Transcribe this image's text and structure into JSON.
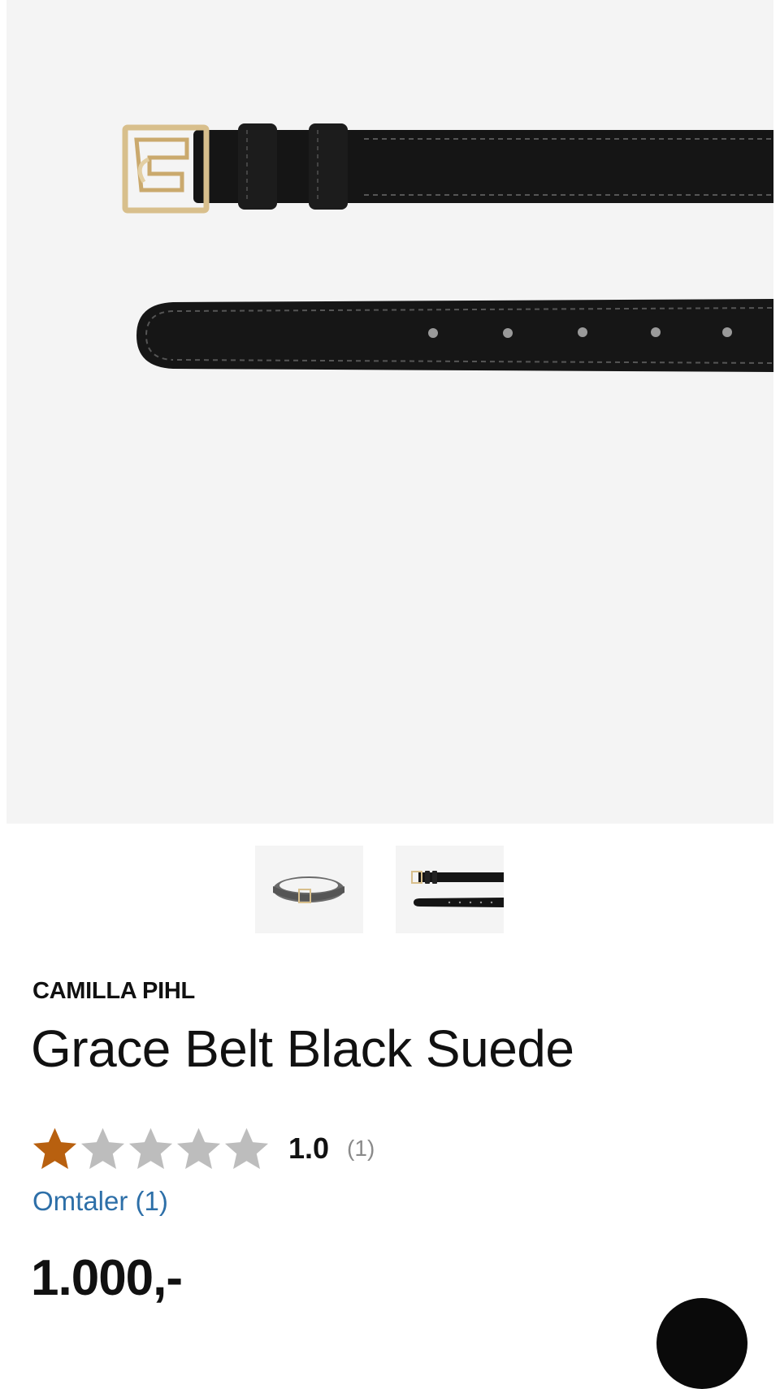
{
  "product": {
    "brand": "CAMILLA PIHL",
    "title": "Grace Belt Black Suede",
    "rating_value": "1.0",
    "rating_count": "(1)",
    "rating_stars": 1,
    "rating_max": 5,
    "reviews_link": "Omtaler (1)",
    "price": "1.000,-"
  },
  "gallery": {
    "main_image": "belt-buckle-and-tip-photo",
    "thumbnails": [
      "belt-coiled-thumbnail",
      "belt-straight-thumbnail"
    ]
  },
  "colors": {
    "star_filled": "#b8600f",
    "star_empty": "#bdbdbd",
    "link": "#2d6fa8",
    "image_background": "#f4f4f4"
  }
}
